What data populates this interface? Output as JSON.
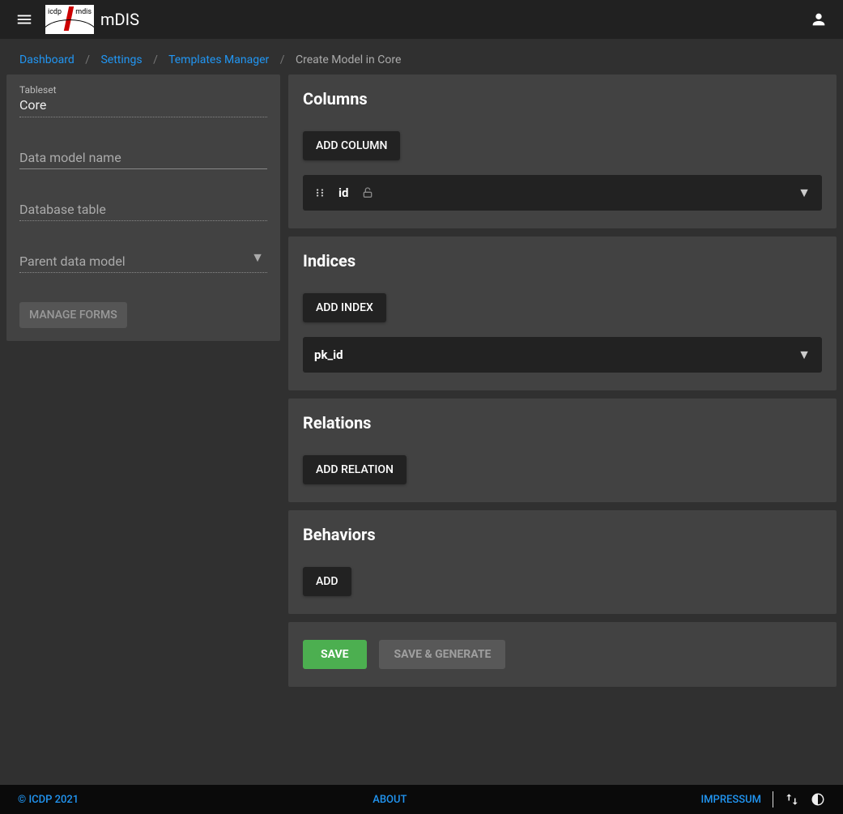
{
  "header": {
    "app_title": "mDIS"
  },
  "breadcrumbs": {
    "items": [
      {
        "label": "Dashboard"
      },
      {
        "label": "Settings"
      },
      {
        "label": "Templates Manager"
      }
    ],
    "current": "Create Model in Core"
  },
  "sidepanel": {
    "tableset": {
      "label": "Tableset",
      "value": "Core"
    },
    "model_name": {
      "placeholder": "Data model name"
    },
    "db_table": {
      "placeholder": "Database table"
    },
    "parent": {
      "placeholder": "Parent data model"
    },
    "manage_forms": "MANAGE FORMS"
  },
  "sections": {
    "columns": {
      "title": "Columns",
      "add": "ADD COLUMN",
      "items": [
        {
          "name": "id",
          "locked": true
        }
      ]
    },
    "indices": {
      "title": "Indices",
      "add": "ADD INDEX",
      "items": [
        {
          "name": "pk_id"
        }
      ]
    },
    "relations": {
      "title": "Relations",
      "add": "ADD RELATION"
    },
    "behaviors": {
      "title": "Behaviors",
      "add": "ADD"
    }
  },
  "actions": {
    "save": "SAVE",
    "save_generate": "SAVE & GENERATE"
  },
  "footer": {
    "copyright": "© ICDP 2021",
    "about": "ABOUT",
    "impressum": "IMPRESSUM"
  }
}
